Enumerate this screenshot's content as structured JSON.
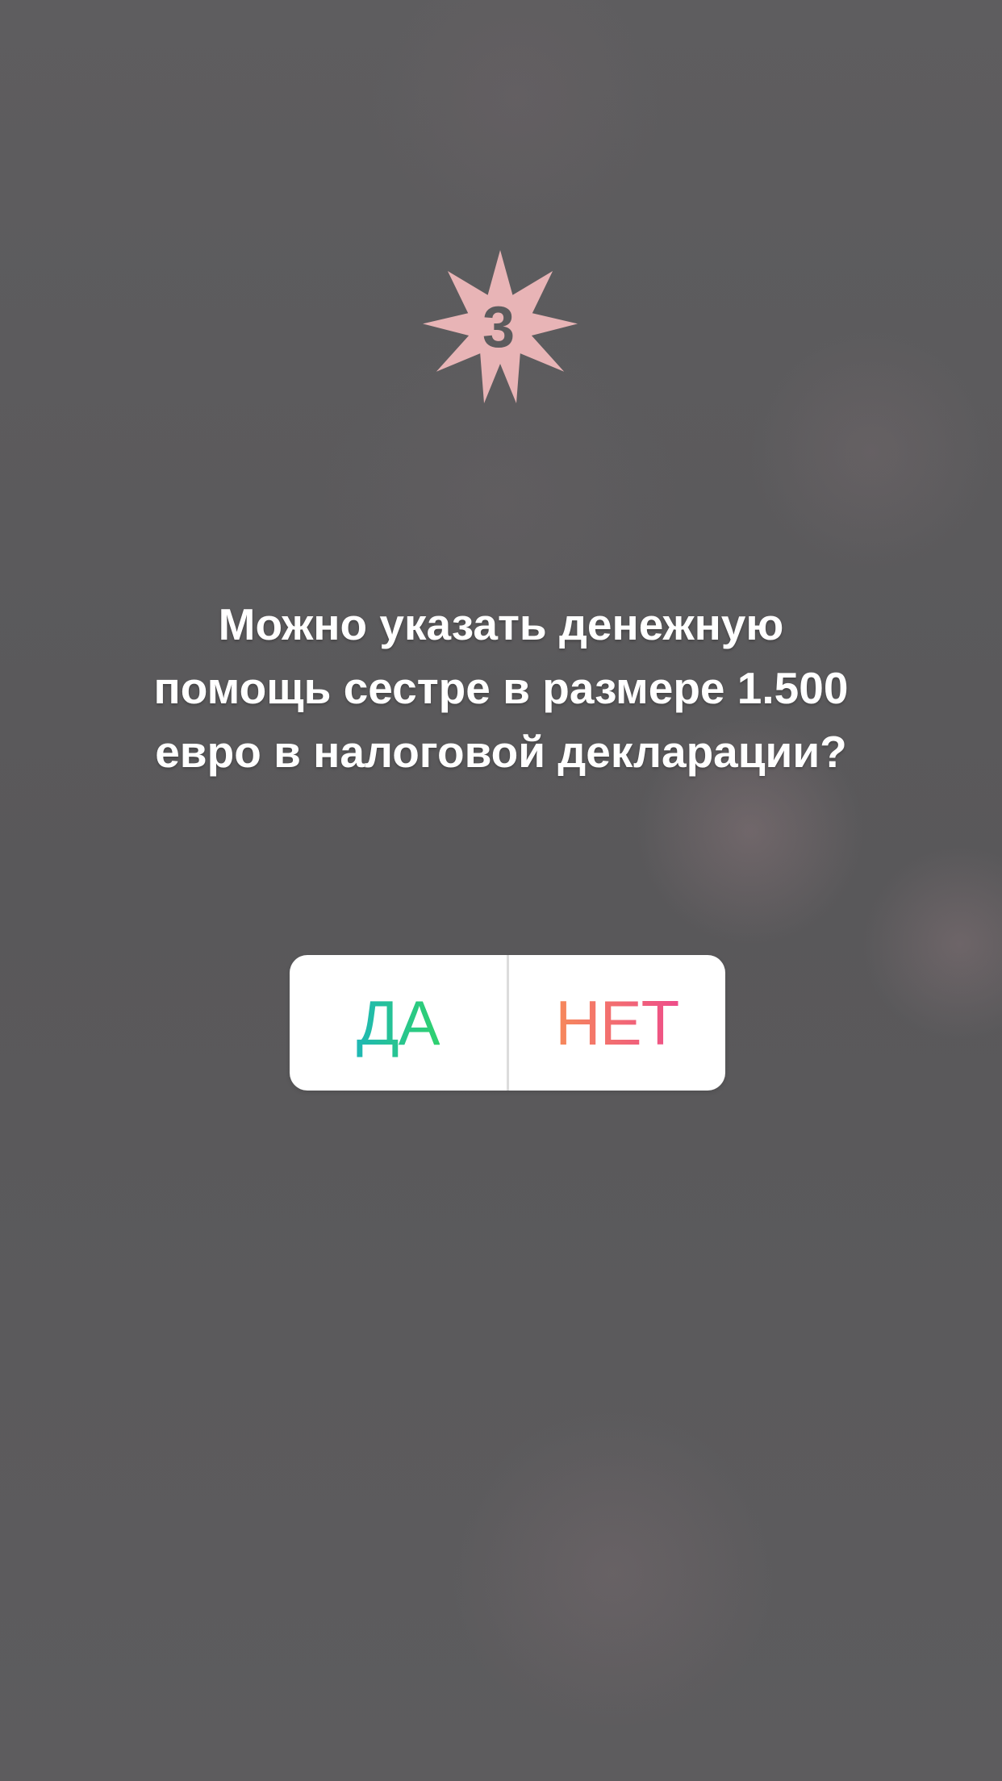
{
  "sticker": {
    "number": "3",
    "star_color": "#e8b4b6",
    "number_color": "#5c5b5d",
    "icon": "star-badge-icon"
  },
  "question": {
    "line1": "Можно указать денежную",
    "line2": "помощь сестре в размере 1.500",
    "line3": "евро в налоговой декларации?"
  },
  "poll": {
    "yes_label": "ДА",
    "no_label": "НЕТ",
    "yes_gradient": [
      "#1fb8b4",
      "#2fd16e"
    ],
    "no_gradient": [
      "#f68a5a",
      "#ee4d8a"
    ]
  }
}
